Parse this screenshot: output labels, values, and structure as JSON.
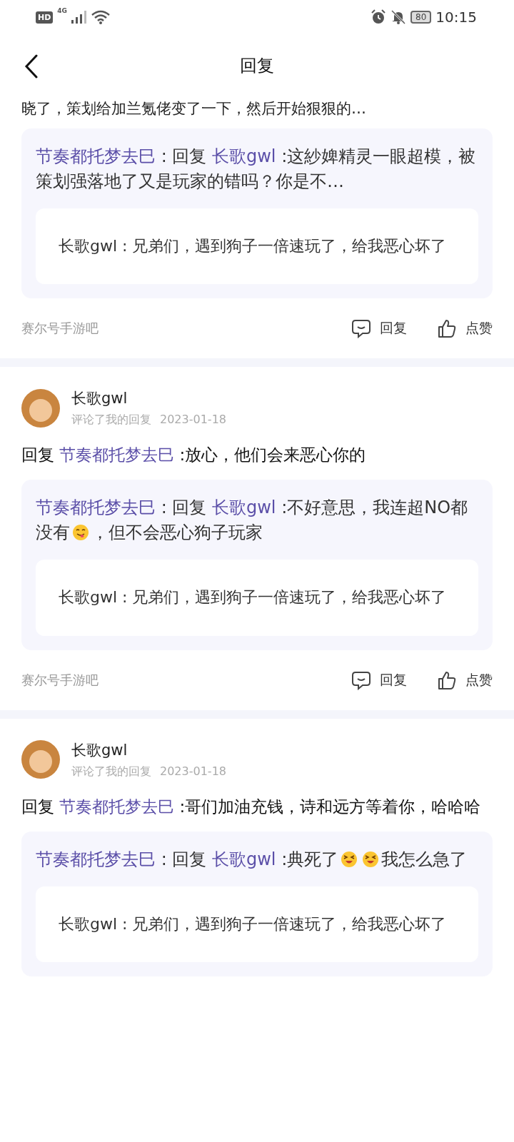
{
  "status_bar": {
    "hd": "HD",
    "network": "4G",
    "battery": "80",
    "time": "10:15"
  },
  "header": {
    "title": "回复"
  },
  "items": [
    {
      "partial_text": "晓了，策划给加兰氪佬变了一下，然后开始狠狠的…",
      "quote": {
        "author": "节奏都托梦去巳",
        "sep": " : 回复 ",
        "target": "长歌gwl",
        "segments": [
          {
            "kind": "text",
            "text": " :这紗婢精灵一眼超模，被策划强落地了又是玩家的错吗？你是不…"
          }
        ]
      },
      "nested": "长歌gwl : 兄弟们，遇到狗子一倍速玩了，给我恶心坏了",
      "forum": "赛尔号手游吧",
      "reply_label": "回复",
      "like_label": "点赞"
    },
    {
      "user": {
        "name": "长歌gwl",
        "action": "评论了我的回复",
        "date": "2023-01-18"
      },
      "body": {
        "prefix": "回复 ",
        "target": "节奏都托梦去巳",
        "text": " :放心，他们会来恶心你的"
      },
      "quote": {
        "author": "节奏都托梦去巳",
        "sep": " : 回复 ",
        "target": "长歌gwl",
        "segments": [
          {
            "kind": "text",
            "text": " :不好意思，我连超NO都没有"
          },
          {
            "kind": "yum"
          },
          {
            "kind": "text",
            "text": "，但不会恶心狗子玩家"
          }
        ]
      },
      "nested": "长歌gwl : 兄弟们，遇到狗子一倍速玩了，给我恶心坏了",
      "forum": "赛尔号手游吧",
      "reply_label": "回复",
      "like_label": "点赞"
    },
    {
      "user": {
        "name": "长歌gwl",
        "action": "评论了我的回复",
        "date": "2023-01-18"
      },
      "body": {
        "prefix": "回复 ",
        "target": "节奏都托梦去巳",
        "text": " :哥们加油充钱，诗和远方等着你，哈哈哈"
      },
      "quote": {
        "author": "节奏都托梦去巳",
        "sep": " : 回复 ",
        "target": "长歌gwl",
        "segments": [
          {
            "kind": "text",
            "text": " :典死了"
          },
          {
            "kind": "grin"
          },
          {
            "kind": "grin"
          },
          {
            "kind": "text",
            "text": "我怎么急了"
          }
        ]
      },
      "nested": "长歌gwl : 兄弟们，遇到狗子一倍速玩了，给我恶心坏了"
    }
  ]
}
